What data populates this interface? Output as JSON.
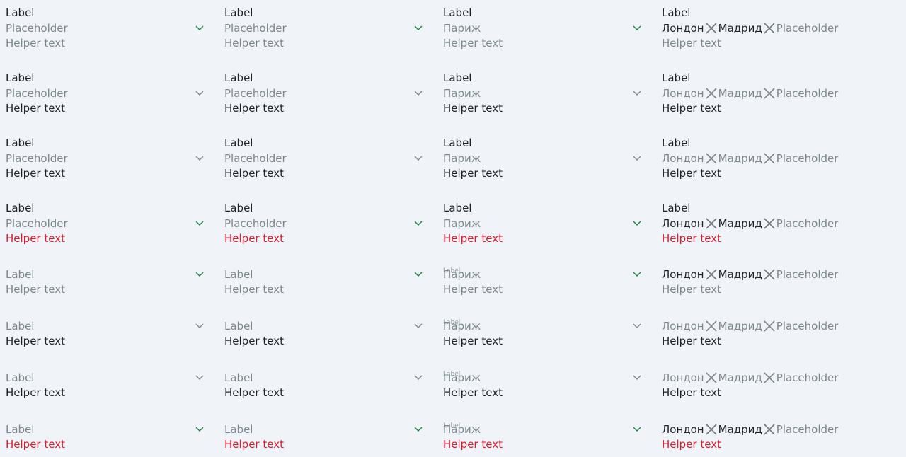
{
  "colors": {
    "background": "#f0f4f8",
    "text": "#1f2328",
    "muted_text": "#7c868f",
    "error_text": "#dc1a2c",
    "active_chevron": "#16843c",
    "passive_chevron": "#7c868f"
  },
  "strings": {
    "label": "Label",
    "placeholder": "Placeholder",
    "helper": "Helper text",
    "paris": "Париж",
    "london": "Лондон",
    "madrid": "Мадрид"
  },
  "rows": [
    {
      "layout": "stacked",
      "state": "active",
      "label_tone": "dark",
      "helper_tone": "muted",
      "chevron": "active"
    },
    {
      "layout": "stacked",
      "state": "default",
      "label_tone": "dark",
      "helper_tone": "dark",
      "chevron": "passive"
    },
    {
      "layout": "stacked",
      "state": "default",
      "label_tone": "dark",
      "helper_tone": "dark",
      "chevron": "passive"
    },
    {
      "layout": "stacked",
      "state": "error",
      "label_tone": "dark",
      "helper_tone": "error",
      "chevron": "active"
    },
    {
      "layout": "inline",
      "state": "active",
      "label_tone": "muted",
      "helper_tone": "muted",
      "chevron": "active"
    },
    {
      "layout": "inline",
      "state": "default",
      "label_tone": "muted",
      "helper_tone": "dark",
      "chevron": "passive"
    },
    {
      "layout": "inline",
      "state": "default",
      "label_tone": "muted",
      "helper_tone": "dark",
      "chevron": "passive"
    },
    {
      "layout": "inline",
      "state": "error",
      "label_tone": "muted",
      "helper_tone": "error",
      "chevron": "active"
    }
  ],
  "columns": [
    {
      "kind": "placeholder"
    },
    {
      "kind": "placeholder"
    },
    {
      "kind": "single-value"
    },
    {
      "kind": "multi-value"
    }
  ]
}
